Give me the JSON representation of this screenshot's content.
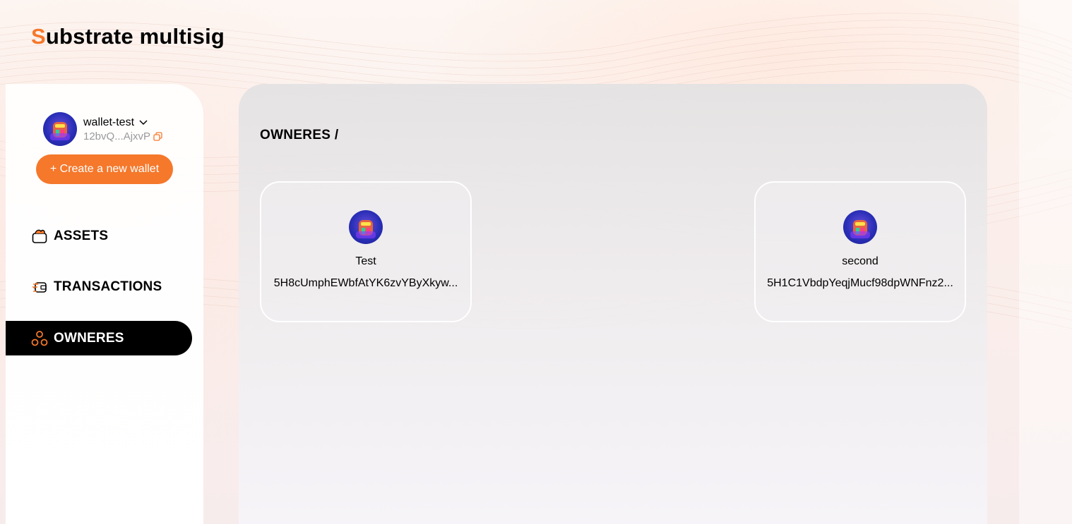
{
  "app": {
    "title_accent": "S",
    "title_rest": "ubstrate multisig"
  },
  "wallet": {
    "name": "wallet-test",
    "address_short": "12bvQ...AjxvP",
    "create_label": "+ Create a new wallet"
  },
  "nav": {
    "assets": "ASSETS",
    "transactions": "TRANSACTIONS",
    "owneres": "OWNERES",
    "active": "owneres"
  },
  "main": {
    "breadcrumb": "OWNERES /"
  },
  "owners": [
    {
      "name": "Test",
      "address": "5H8cUmphEWbfAtYK6zvYByXkyw..."
    },
    {
      "name": "second",
      "address": "5H1C1VbdpYeqjMucf98dpWNFnz2..."
    }
  ],
  "colors": {
    "accent": "#f5782b",
    "active_nav_bg": "#000000"
  }
}
